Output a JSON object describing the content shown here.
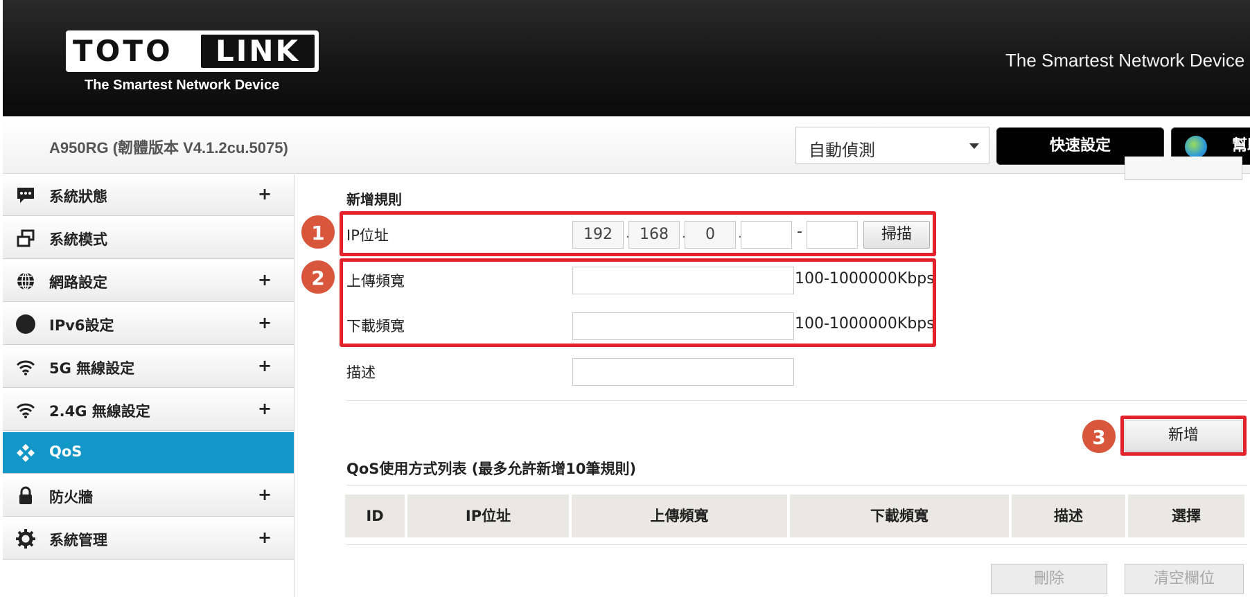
{
  "header": {
    "logo_left": "TOTO",
    "logo_right": "LINK",
    "logo_tagline": "The Smartest Network Device",
    "slogan": "The Smartest Network Device"
  },
  "toolbar": {
    "model": "A950RG (韌體版本 V4.1.2cu.5075)",
    "language_selected": "自動偵測",
    "quick_setup": "快速設定",
    "help": "幫助"
  },
  "sidebar": {
    "items": [
      {
        "label": "系統狀態",
        "icon": "status-icon",
        "expandable": true
      },
      {
        "label": "系統模式",
        "icon": "mode-icon",
        "expandable": false
      },
      {
        "label": "網路設定",
        "icon": "globe-icon",
        "expandable": true
      },
      {
        "label": "IPv6設定",
        "icon": "ipv6-icon",
        "expandable": true
      },
      {
        "label": "5G 無線設定",
        "icon": "wifi-icon",
        "expandable": true
      },
      {
        "label": "2.4G 無線設定",
        "icon": "wifi-icon",
        "expandable": true
      },
      {
        "label": "QoS",
        "icon": "qos-icon",
        "expandable": false,
        "active": true
      },
      {
        "label": "防火牆",
        "icon": "lock-icon",
        "expandable": true
      },
      {
        "label": "系統管理",
        "icon": "gear-icon",
        "expandable": true
      }
    ],
    "plus": "+"
  },
  "form": {
    "section_title": "新增規則",
    "ip_label": "IP位址",
    "ip_parts": [
      "192",
      "168",
      "0",
      ""
    ],
    "ip_end": "",
    "ip_dot": ".",
    "ip_dash": "-",
    "scan_button": "掃描",
    "upload_label": "上傳頻寬",
    "upload_value": "",
    "upload_hint": "100-1000000Kbps",
    "download_label": "下載頻寬",
    "download_value": "",
    "download_hint": "100-1000000Kbps",
    "desc_label": "描述",
    "desc_value": "",
    "add_button": "新增"
  },
  "badges": [
    "1",
    "2",
    "3"
  ],
  "list": {
    "title": "QoS使用方式列表 (最多允許新增10筆規則)",
    "columns": [
      "ID",
      "IP位址",
      "上傳頻寬",
      "下載頻寬",
      "描述",
      "選擇"
    ],
    "delete_button": "刪除",
    "clear_button": "清空欄位"
  },
  "colors": {
    "accent": "#1397c8",
    "highlight": "#e3232c",
    "badge": "#d8573c"
  }
}
